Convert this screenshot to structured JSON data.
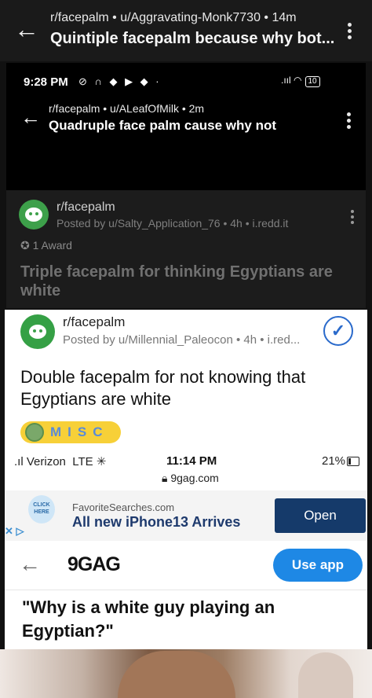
{
  "header1": {
    "meta": "r/facepalm • u/Aggravating-Monk7730 • 14m",
    "title": "Quintiple facepalm because why bot..."
  },
  "screenshot2": {
    "time": "9:28 PM",
    "status_icons": "⊘ ∩ ◆ ▶ ◆ ·",
    "signal": ".ııl",
    "battery": "10",
    "meta": "r/facepalm • u/ALeafOfMilk • 2m",
    "title": "Quadruple face palm cause why not"
  },
  "screenshot3": {
    "subreddit": "r/facepalm",
    "posted": "Posted by u/Salty_Application_76 • 4h • i.redd.it",
    "award": "1 Award",
    "title": "Triple facepalm for thinking Egyptians are white"
  },
  "screenshot4": {
    "subreddit": "r/facepalm",
    "posted": "Posted by u/Millennial_Paleocon • 4h • i.red...",
    "title": "Double facepalm for not knowing that Egyptians are white",
    "flair": "MISC"
  },
  "phone_status": {
    "carrier": "Verizon",
    "network": "LTE",
    "time": "11:14 PM",
    "battery": "21%",
    "url": "9gag.com"
  },
  "ad": {
    "logo_text": "CLICK HERE",
    "site": "FavoriteSearches.com",
    "title": "All new iPhone13 Arrives",
    "button": "Open",
    "close": "✕ ▷"
  },
  "gag": {
    "logo": "9GAG",
    "use_app": "Use app",
    "quote": "\"Why is a white guy playing an Egyptian?\""
  }
}
